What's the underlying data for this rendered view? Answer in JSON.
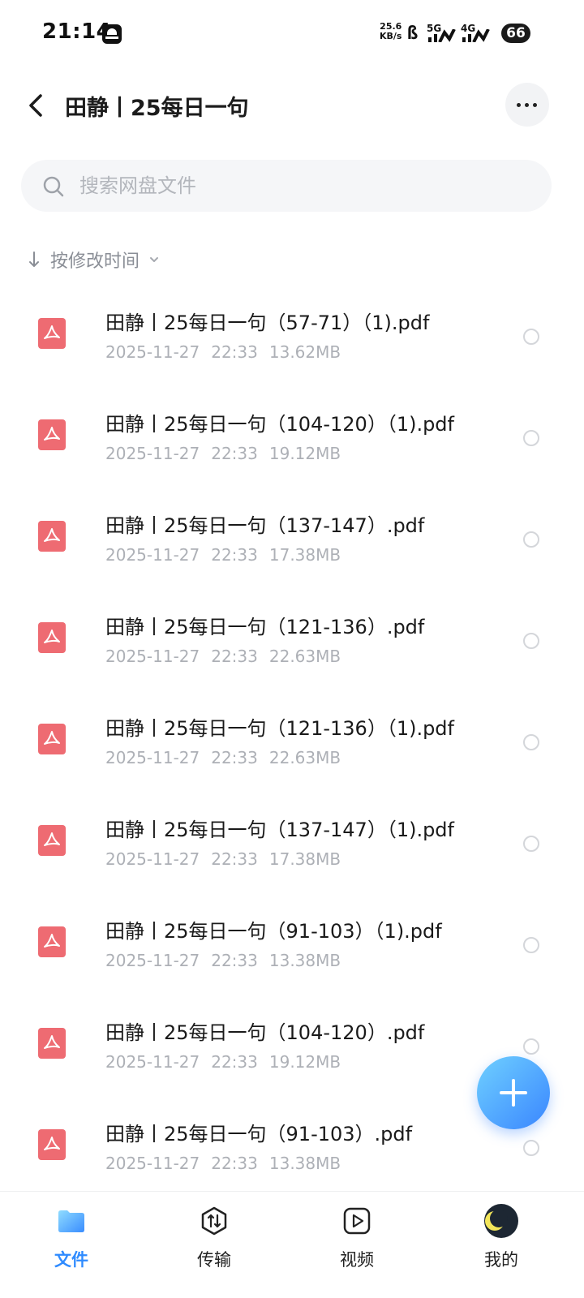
{
  "status_bar": {
    "time": "21:14",
    "net_speed_value": "25.6",
    "net_speed_unit": "KB/s",
    "bluetooth": "ß",
    "sim1": "5G",
    "sim2": "4G",
    "battery": "66"
  },
  "header": {
    "title": "田静丨25每日一句"
  },
  "search": {
    "placeholder": "搜索网盘文件"
  },
  "sort": {
    "label": "按修改时间"
  },
  "files": [
    {
      "name": "田静丨25每日一句（57-71）（1).pdf",
      "date": "2025-11-27",
      "time": "22:33",
      "size": "13.62MB"
    },
    {
      "name": "田静丨25每日一句（104-120）（1).pdf",
      "date": "2025-11-27",
      "time": "22:33",
      "size": "19.12MB"
    },
    {
      "name": "田静丨25每日一句（137-147）.pdf",
      "date": "2025-11-27",
      "time": "22:33",
      "size": "17.38MB"
    },
    {
      "name": "田静丨25每日一句（121-136）.pdf",
      "date": "2025-11-27",
      "time": "22:33",
      "size": "22.63MB"
    },
    {
      "name": "田静丨25每日一句（121-136）（1).pdf",
      "date": "2025-11-27",
      "time": "22:33",
      "size": "22.63MB"
    },
    {
      "name": "田静丨25每日一句（137-147）（1).pdf",
      "date": "2025-11-27",
      "time": "22:33",
      "size": "17.38MB"
    },
    {
      "name": "田静丨25每日一句（91-103）（1).pdf",
      "date": "2025-11-27",
      "time": "22:33",
      "size": "13.38MB"
    },
    {
      "name": "田静丨25每日一句（104-120）.pdf",
      "date": "2025-11-27",
      "time": "22:33",
      "size": "19.12MB"
    },
    {
      "name": "田静丨25每日一句（91-103）.pdf",
      "date": "2025-11-27",
      "time": "22:33",
      "size": "13.38MB"
    }
  ],
  "bottom_nav": [
    {
      "label": "文件",
      "icon": "folder-icon",
      "active": true
    },
    {
      "label": "传输",
      "icon": "transfer-icon",
      "active": false
    },
    {
      "label": "视频",
      "icon": "video-play-icon",
      "active": false
    },
    {
      "label": "我的",
      "icon": "avatar-moon-icon",
      "active": false
    }
  ],
  "colors": {
    "accent": "#2f8bff",
    "pdf_icon": "#ee6b72",
    "meta_text": "#adb0b6",
    "fab_gradient_start": "#6fd0ff",
    "fab_gradient_end": "#3a86ff"
  }
}
